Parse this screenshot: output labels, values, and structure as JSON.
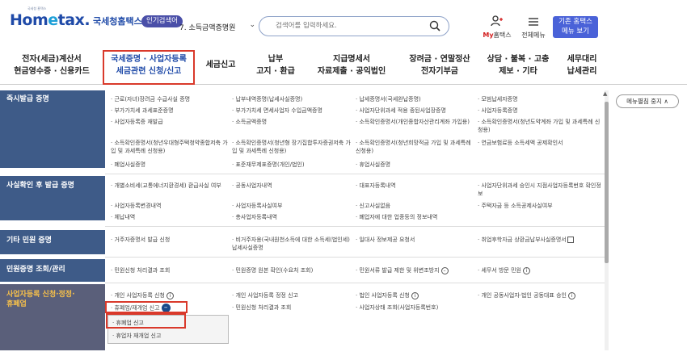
{
  "header": {
    "logo_tiny": "국세청 홈택스",
    "logo_main_a": "Hom",
    "logo_main_e": "e",
    "logo_main_b": "tax.",
    "logo_sub": "국세청홈택스",
    "popular_badge": "인기검색어",
    "popular_item": "7. 소득금액증명원",
    "search_placeholder": "검색어를 입력하세요.",
    "my_label_a": "My",
    "my_label_b": "홈택스",
    "menu_label": "전체메뉴",
    "basic_line1": "기존 홈택스",
    "basic_line2": "메뉴 보기"
  },
  "nav": {
    "items": [
      {
        "l1": "전자(세금)계산서",
        "l2": "현금영수증 · 신용카드"
      },
      {
        "l1": "국세증명 · 사업자등록",
        "l2": "세금관련 신청/신고"
      },
      {
        "l1": "세금신고",
        "l2": ""
      },
      {
        "l1": "납부",
        "l2": "고지 · 환급"
      },
      {
        "l1": "지급명세서",
        "l2": "자료제출 · 공익법인"
      },
      {
        "l1": "장려금 · 연말정산",
        "l2": "전자기부금"
      },
      {
        "l1": "상담 · 불복 · 고충",
        "l2": "제보 · 기타"
      },
      {
        "l1": "세무대리",
        "l2": "납세관리"
      }
    ]
  },
  "categories": [
    {
      "label": "즉시발급 증명"
    },
    {
      "label": "사실확인 후 발급 증명"
    },
    {
      "label": "기타 민원 증명"
    },
    {
      "label": "민원증명 조회/관리"
    },
    {
      "label": "사업자등록 신청·정정·",
      "label2": "휴폐업"
    }
  ],
  "rows": {
    "r1": [
      "· 근로(자녀)장려금 수급사실 증명",
      "· 납부내역증명(납세사실증명)",
      "· 납세증명서(국세완납증명)",
      "· 모범납세자증명",
      "· 부가가치세 과세표준증명",
      "· 부가가치세 면세사업자 수입금액증명",
      "· 사업자단위과세 적용 종된사업장증명",
      "· 사업자등록증명",
      "· 사업자등록증 재발급",
      "· 소득금액증명",
      "· 소득확인증명서(개인종합자산관리계좌 가입용)",
      "· 소득확인증명서(청년도약계좌 가입 및 과세특례 신청용)",
      "· 소득확인증명서(청년우대형주택청약종합저축 가입 및 과세특례 신청용)",
      "· 소득확인증명서(청년형 장기집합투자증권저축 가입 및 과세특례 신청용)",
      "· 소득확인증명서(청년희망적금 가입 및 과세특례 신청용)",
      "· 연금보험료등 소득세액 공제확인서",
      "· 폐업사실증명",
      "· 표준재무제표증명(개인/법인)",
      "· 휴업사실증명"
    ],
    "r2": [
      "· 개별소비세(교통에너지환경세) 환급사실 여부",
      "· 공동사업자내역",
      "· 대표자등록내역",
      "· 사업자단위과세 승인시 지점사업자등록번호 확인정보",
      "· 사업자등록변경내역",
      "· 사업자등록사실여부",
      "· 신고사실없음",
      "· 주택자금 등 소득공제사실여부",
      "· 체납내역",
      "· 총사업자등록내역",
      "· 폐업자에 대한 업종등의 정보내역"
    ],
    "r3": [
      "· 거주자증명서 발급 신청",
      "· 비거주자용(국내원천소득에 대한 소득세(법인세) 납세사실증명",
      "· 일대사 정보제공 요청서",
      "· 취업후학자금 상환금납부사실증명서"
    ],
    "r4": [
      "· 민원신청 처리결과 조회",
      "· 민원증명 원본 확인(수요처 조회)",
      "· 민원서류 발급 제한 및 위변조방지",
      "· 세무서 방문 민원"
    ],
    "r5": [
      "· 개인 사업자등록 신청",
      "· 개인 사업자등록 정정 신고",
      "· 법인 사업자등록 신청",
      "· 개인 공동사업자·법인 공동대표 승인",
      "· 휴폐업/재개업 신고",
      "· 민원신청 처리결과 조회",
      "· 사업자상태 조회(사업자등록번호)"
    ]
  },
  "submenu": [
    "· 휴폐업 신고",
    "· 휴업자 재개업 신고"
  ],
  "menu_toggle": "메뉴펼침 중지"
}
